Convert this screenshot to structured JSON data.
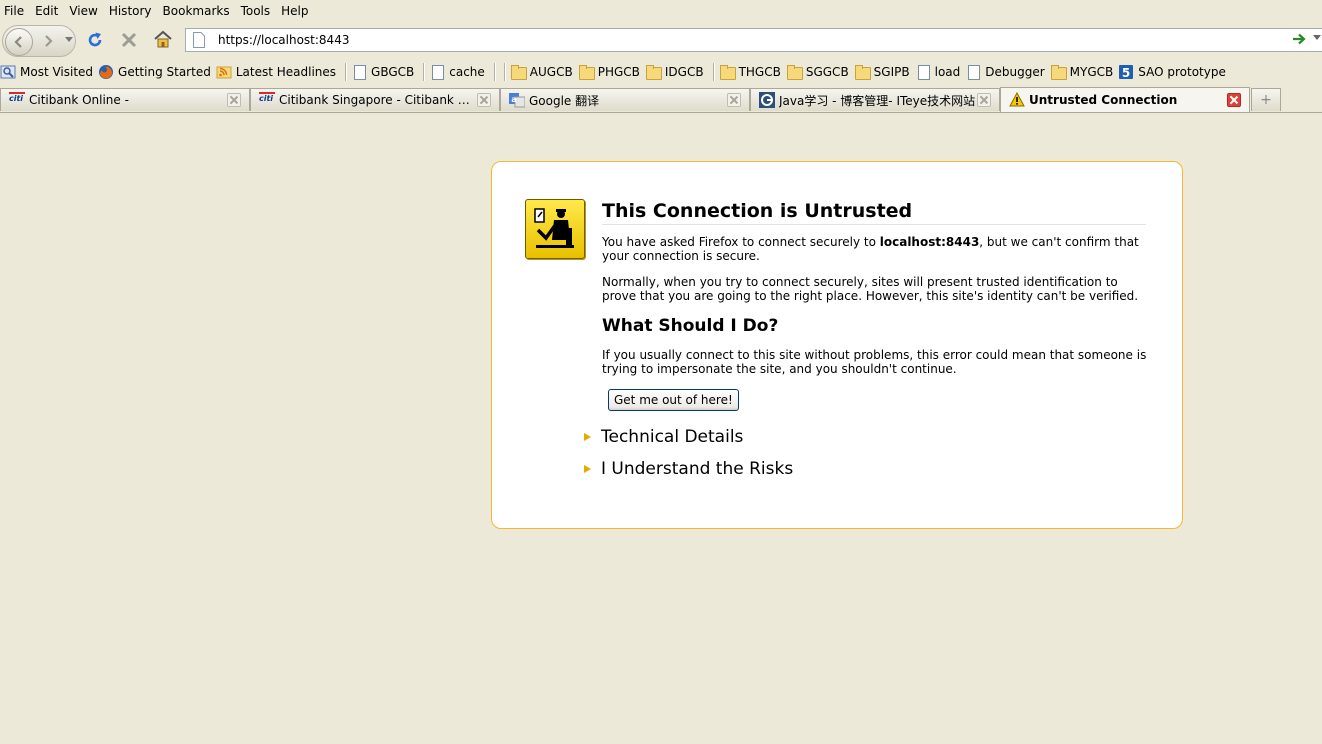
{
  "menubar": {
    "items": [
      "File",
      "Edit",
      "View",
      "History",
      "Bookmarks",
      "Tools",
      "Help"
    ]
  },
  "navbar": {
    "url": "https://localhost:8443",
    "icons": [
      "back-icon",
      "forward-icon",
      "history-dropdown-icon",
      "reload-icon",
      "stop-icon",
      "home-icon",
      "page-icon",
      "go-icon"
    ]
  },
  "bookmarks": {
    "items": [
      {
        "label": "Most Visited",
        "icon": "most-visited-icon"
      },
      {
        "label": "Getting Started",
        "icon": "firefox-icon"
      },
      {
        "label": "Latest Headlines",
        "icon": "rss-icon"
      },
      {
        "label": "GBGCB",
        "icon": "page-icon"
      },
      {
        "label": "cache",
        "icon": "page-icon"
      },
      {
        "label": "AUGCB",
        "icon": "folder-icon"
      },
      {
        "label": "PHGCB",
        "icon": "folder-icon"
      },
      {
        "label": "IDGCB",
        "icon": "folder-icon"
      },
      {
        "label": "THGCB",
        "icon": "folder-icon"
      },
      {
        "label": "SGGCB",
        "icon": "folder-icon"
      },
      {
        "label": "SGIPB",
        "icon": "folder-icon"
      },
      {
        "label": "load",
        "icon": "page-icon"
      },
      {
        "label": "Debugger",
        "icon": "page-icon"
      },
      {
        "label": "MYGCB",
        "icon": "folder-icon"
      },
      {
        "label": "SAO prototype",
        "icon": "html5-icon"
      }
    ]
  },
  "tabs": [
    {
      "title": "Citibank Online -",
      "icon": "citi-icon"
    },
    {
      "title": "Citibank Singapore - Citibank Onlin...",
      "icon": "citi-icon"
    },
    {
      "title": "Google 翻译",
      "icon": "google-translate-icon"
    },
    {
      "title": "Java学习 - 博客管理- ITeye技术网站",
      "icon": "iteye-icon"
    },
    {
      "title": "Untrusted Connection",
      "icon": "warning-icon",
      "active": true
    }
  ],
  "error": {
    "title": "This Connection is Untrusted",
    "p1_before": "You have asked Firefox to connect securely to ",
    "p1_host": "localhost:8443",
    "p1_after": ", but we can't confirm that your connection is secure.",
    "p2": "Normally, when you try to connect securely, sites will present trusted identification to prove that you are going to the right place. However, this site's identity can't be verified.",
    "subtitle": "What Should I Do?",
    "p3": "If you usually connect to this site without problems, this error could mean that someone is trying to impersonate the site, and you shouldn't continue.",
    "button": "Get me out of here!",
    "expanders": [
      "Technical Details",
      "I Understand the Risks"
    ]
  },
  "colors": {
    "background": "#ece9d8",
    "box_border": "#f5b82e",
    "icon_yellow": "#ffe94a"
  }
}
